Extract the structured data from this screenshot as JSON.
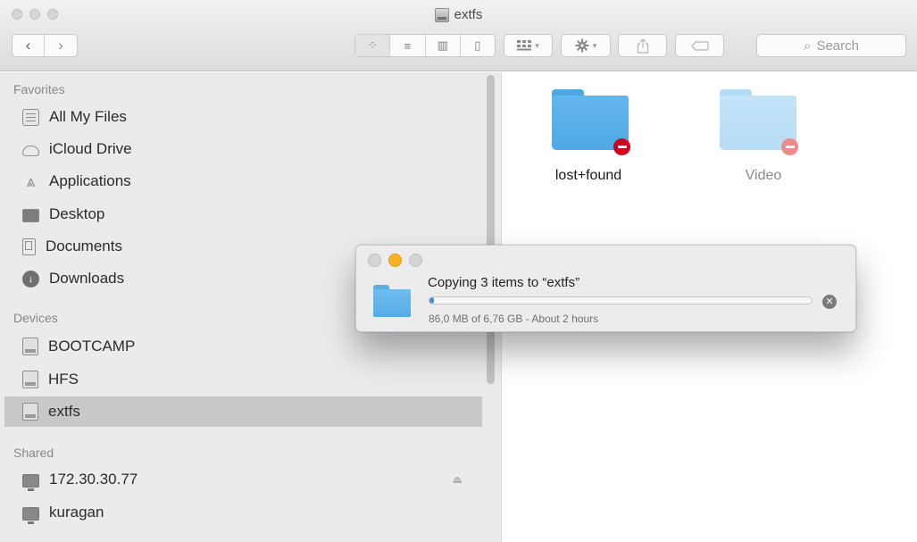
{
  "window": {
    "title": "extfs"
  },
  "toolbar": {
    "back_icon": "‹",
    "forward_icon": "›",
    "view_buttons": [
      {
        "name": "icon-view",
        "glyph": "⁘"
      },
      {
        "name": "list-view",
        "glyph": "≡"
      },
      {
        "name": "column-view",
        "glyph": "▥"
      },
      {
        "name": "cover-flow-view",
        "glyph": "▯"
      }
    ],
    "search_placeholder": "Search",
    "search_icon": "⌕"
  },
  "sidebar": {
    "favorites_header": "Favorites",
    "favorites": [
      {
        "label": "All My Files",
        "icon": "all-my-files-icon"
      },
      {
        "label": "iCloud Drive",
        "icon": "icloud-drive-icon"
      },
      {
        "label": "Applications",
        "icon": "applications-icon"
      },
      {
        "label": "Desktop",
        "icon": "desktop-icon"
      },
      {
        "label": "Documents",
        "icon": "documents-icon"
      },
      {
        "label": "Downloads",
        "icon": "downloads-icon"
      }
    ],
    "devices_header": "Devices",
    "devices": [
      {
        "label": "BOOTCAMP",
        "icon": "disk-icon"
      },
      {
        "label": "HFS",
        "icon": "disk-icon"
      },
      {
        "label": "extfs",
        "icon": "disk-icon",
        "selected": true
      }
    ],
    "shared_header": "Shared",
    "shared": [
      {
        "label": "172.30.30.77",
        "icon": "network-computer-icon",
        "eject": "⏏"
      },
      {
        "label": "kuragan",
        "icon": "network-computer-icon"
      }
    ]
  },
  "content": {
    "items": [
      {
        "label": "lost+found",
        "icon": "folder-icon",
        "dimmed": false
      },
      {
        "label": "Video",
        "icon": "folder-icon",
        "dimmed": true
      }
    ]
  },
  "copy_dialog": {
    "title": "Copying 3 items to “extfs”",
    "status": "86,0 MB of 6,76 GB - About 2 hours",
    "progress_fraction": 0.0127,
    "cancel_glyph": "✕"
  },
  "colors": {
    "progress": "#3d8ee0",
    "folder": "#5ab0e8",
    "no_entry_badge": "#d0021b",
    "minimize_dot": "#f5b324"
  }
}
